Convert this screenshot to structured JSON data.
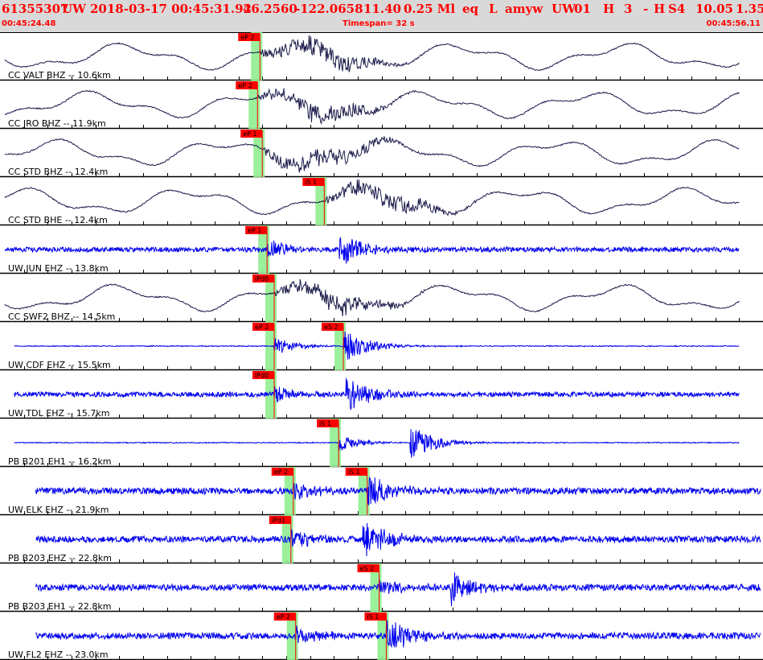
{
  "header": {
    "event_id": "61355307",
    "network": "UW",
    "datetime": "2018-03-17 00:45:31.92",
    "lat": "46.2560",
    "lon": "-122.0658",
    "depth": "11.40",
    "magnitude": "0.25 Ml",
    "event_type": "eq",
    "event_code": "L",
    "analyst": "amyw",
    "quality_net": "UW",
    "quality_code": "01",
    "q1": "H",
    "q2": "3",
    "q3": "-",
    "q4": "H",
    "q5": "S4",
    "rms": "10.05",
    "last": "1.35"
  },
  "time_bar": {
    "start": "00:45:24.48",
    "span_label": "Timespan=  32 s",
    "end": "00:45:56.11"
  },
  "colors": {
    "pick": "#ff0000",
    "window": "#90ee90",
    "trace_bh": "#1a1a4a",
    "trace_eh": "#0000ee",
    "header_bg": "#d9d9d9"
  },
  "traces": [
    {
      "label": "CC VALT BHZ -- 10.6km",
      "channel": "BH",
      "picks": [
        {
          "label": "eP 2",
          "time": 10.9
        }
      ]
    },
    {
      "label": "CC JRO BHZ -- 11.9km",
      "channel": "BH",
      "picks": [
        {
          "label": "eP 2",
          "time": 10.8
        }
      ]
    },
    {
      "label": "CC STD BHZ -- 12.4km",
      "channel": "BH",
      "picks": [
        {
          "label": "eP 1",
          "time": 11.0
        }
      ]
    },
    {
      "label": "CC STD BHE -- 12.4km",
      "channel": "BH",
      "picks": [
        {
          "label": "iS 1",
          "time": 13.6
        }
      ]
    },
    {
      "label": "UW JUN EHZ -- 13.8km",
      "channel": "EH",
      "picks": [
        {
          "label": "eP 1",
          "time": 11.2
        }
      ]
    },
    {
      "label": "CC SWF2 BHZ -- 14.5km",
      "channel": "BH",
      "picks": [
        {
          "label": "iPd0",
          "time": 11.5
        }
      ]
    },
    {
      "label": "UW CDF EHZ -- 15.5km",
      "channel": "EH",
      "picks": [
        {
          "label": "eP 2",
          "time": 11.5
        },
        {
          "label": "eS 2",
          "time": 14.4
        }
      ]
    },
    {
      "label": "UW TDL EHZ -- 15.7km",
      "channel": "EH",
      "picks": [
        {
          "label": "iPd0",
          "time": 11.5
        }
      ]
    },
    {
      "label": "PB B201 EH1 -- 16.2km",
      "channel": "EH",
      "picks": [
        {
          "label": "iS 1",
          "time": 14.2
        }
      ]
    },
    {
      "label": "UW ELK EHZ -- 21.9km",
      "channel": "EH",
      "picks": [
        {
          "label": "eP 2",
          "time": 12.3
        },
        {
          "label": "iS 1",
          "time": 15.4
        }
      ]
    },
    {
      "label": "PB B203 EHZ -- 22.8km",
      "channel": "EH",
      "picks": [
        {
          "label": "iPd1",
          "time": 12.2
        }
      ]
    },
    {
      "label": "PB B203 EH1 -- 22.8km",
      "channel": "EH",
      "picks": [
        {
          "label": "eS 2",
          "time": 15.9
        }
      ]
    },
    {
      "label": "UW FL2 EHZ -- 23.0km",
      "channel": "EH",
      "picks": [
        {
          "label": "eP 2",
          "time": 12.4
        },
        {
          "label": "iS 1",
          "time": 16.2
        }
      ]
    }
  ]
}
